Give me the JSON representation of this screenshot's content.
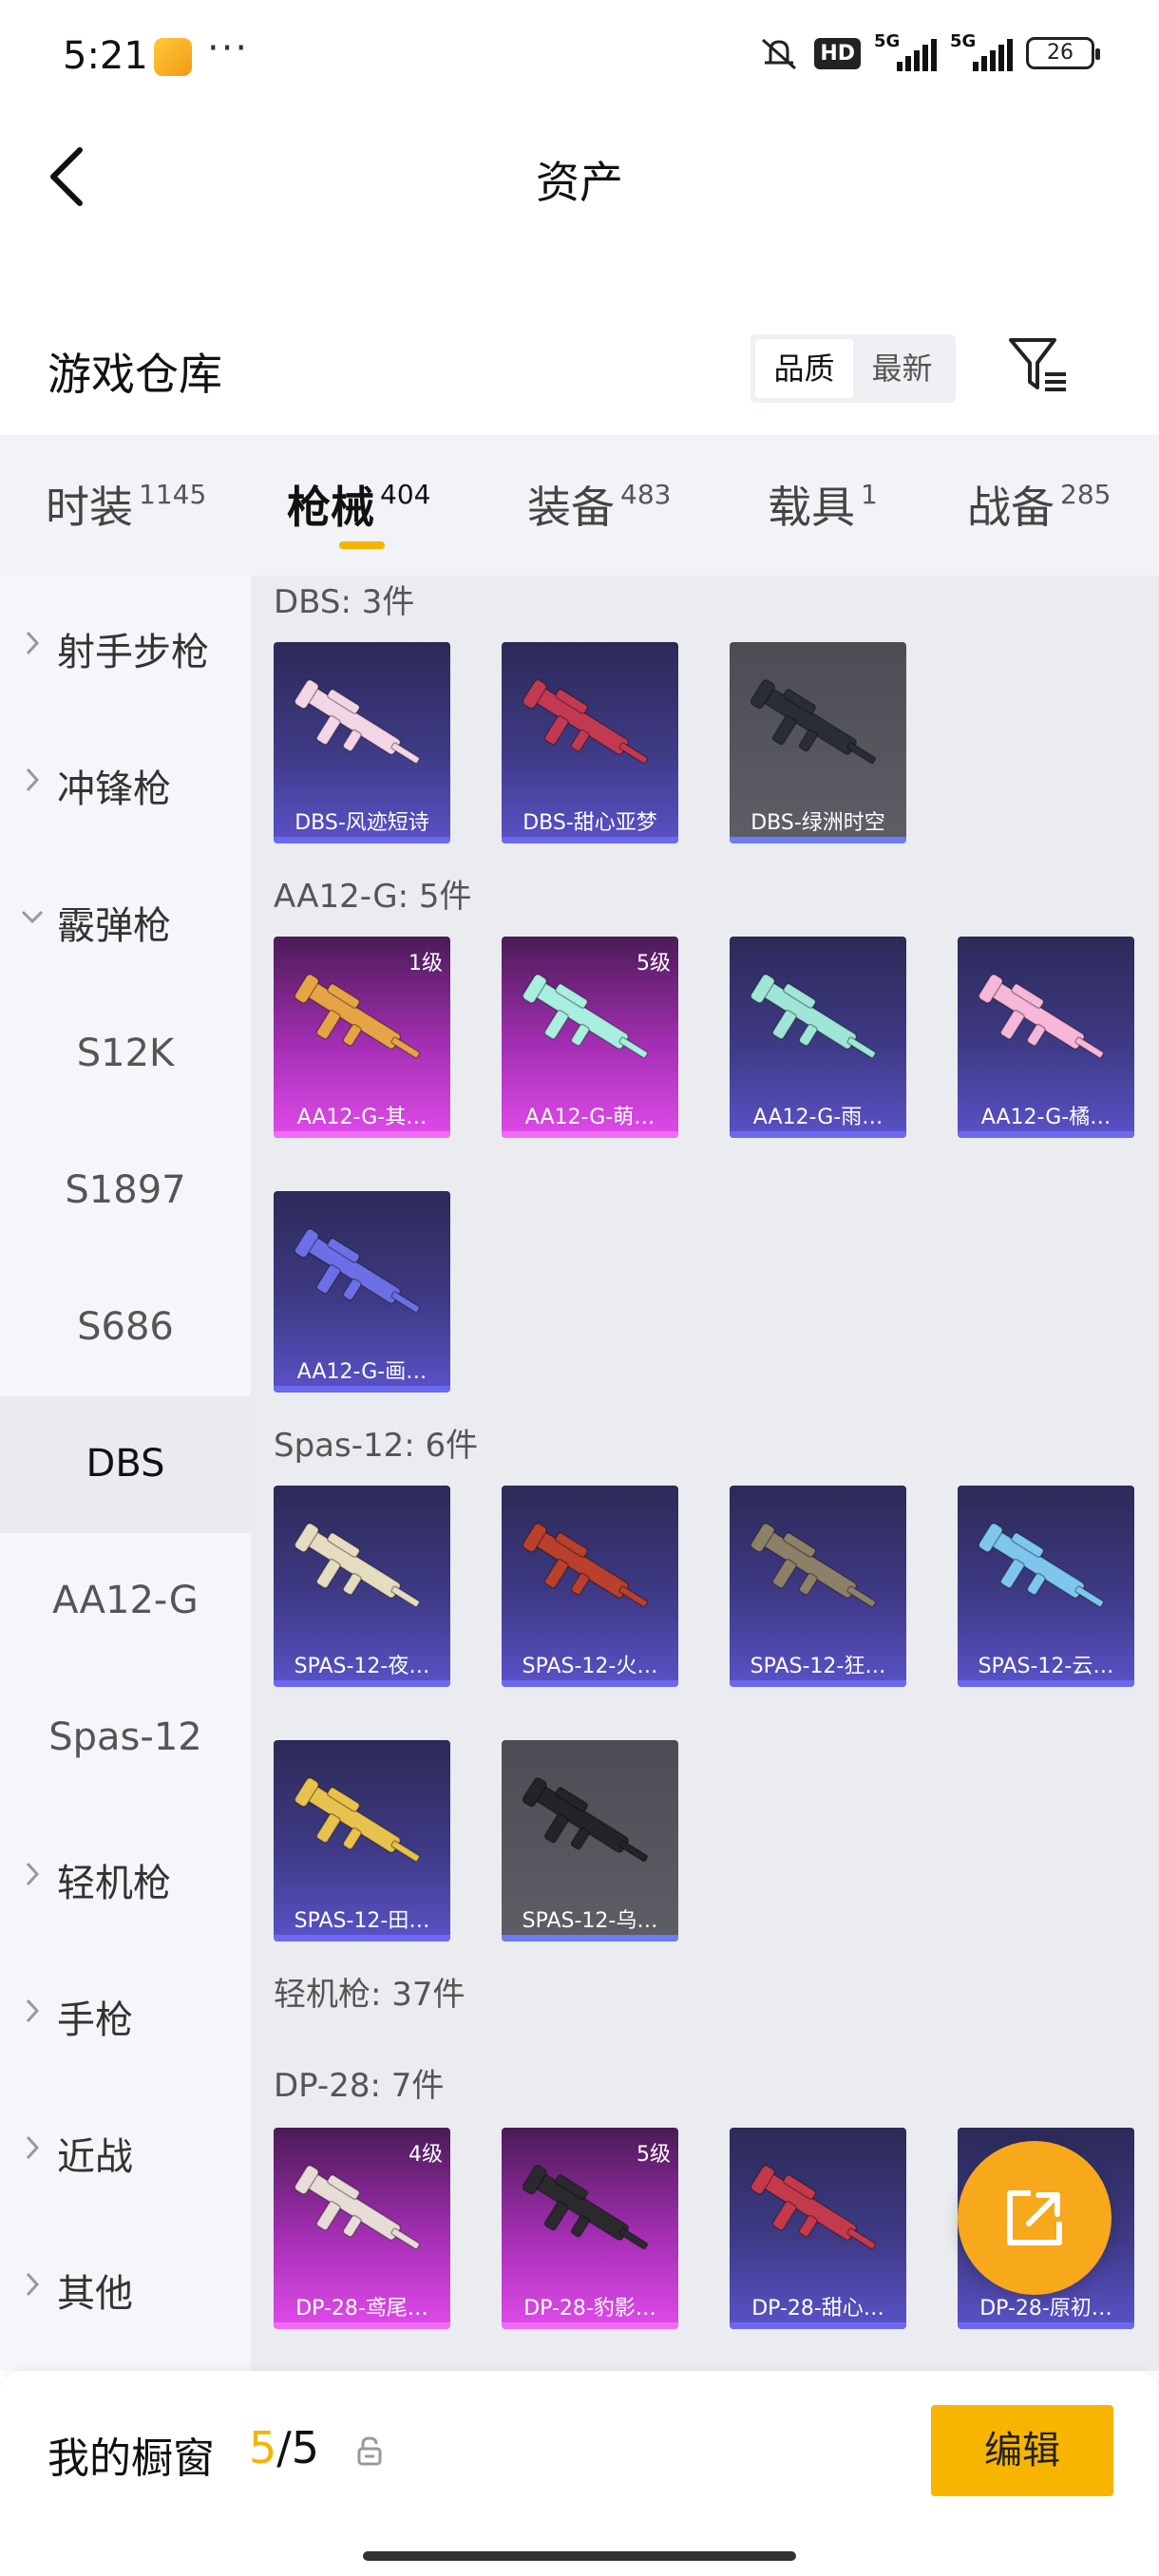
{
  "status_bar": {
    "time": "5:21",
    "dots": "···",
    "hd": "HD",
    "network1": "5G",
    "network2": "5G",
    "battery": "26"
  },
  "header": {
    "title": "资产"
  },
  "section": {
    "title": "游戏仓库",
    "sort_options": [
      "品质",
      "最新"
    ],
    "active_sort": "品质"
  },
  "tabs": [
    {
      "label": "时装",
      "count": "1145"
    },
    {
      "label": "枪械",
      "count": "404",
      "active": true
    },
    {
      "label": "装备",
      "count": "483"
    },
    {
      "label": "载具",
      "count": "1"
    },
    {
      "label": "战备",
      "count": "285"
    }
  ],
  "sidebar": [
    {
      "label": "射手步枪",
      "kind": "collapsed"
    },
    {
      "label": "冲锋枪",
      "kind": "collapsed"
    },
    {
      "label": "霰弹枪",
      "kind": "expanded"
    },
    {
      "label": "S12K",
      "kind": "sub"
    },
    {
      "label": "S1897",
      "kind": "sub"
    },
    {
      "label": "S686",
      "kind": "sub"
    },
    {
      "label": "DBS",
      "kind": "sub",
      "selected": true
    },
    {
      "label": "AA12-G",
      "kind": "sub"
    },
    {
      "label": "Spas-12",
      "kind": "sub"
    },
    {
      "label": "轻机枪",
      "kind": "collapsed"
    },
    {
      "label": "手枪",
      "kind": "collapsed"
    },
    {
      "label": "近战",
      "kind": "collapsed"
    },
    {
      "label": "其他",
      "kind": "collapsed"
    }
  ],
  "groups": {
    "dbs": {
      "label": "DBS: 3件"
    },
    "aa12": {
      "label": "AA12-G: 5件"
    },
    "spas": {
      "label": "Spas-12: 6件"
    },
    "lmg": {
      "label": "轻机枪: 37件"
    },
    "dp28": {
      "label": "DP-28: 7件"
    }
  },
  "cards": {
    "dbs": [
      {
        "name": "DBS-风迹短诗",
        "rarity": "purple",
        "gun_color": "#f3d6e6"
      },
      {
        "name": "DBS-甜心亚梦",
        "rarity": "purple",
        "gun_color": "#c23a52"
      },
      {
        "name": "DBS-绿洲时空",
        "rarity": "gray",
        "gun_color": "#2a2d36"
      }
    ],
    "aa12": [
      {
        "name": "AA12-G-其…",
        "rarity": "pink",
        "level": "1级",
        "gun_color": "#e6a446"
      },
      {
        "name": "AA12-G-萌…",
        "rarity": "pink",
        "level": "5级",
        "gun_color": "#a8efe0"
      },
      {
        "name": "AA12-G-雨…",
        "rarity": "purple",
        "gun_color": "#9fe6d8"
      },
      {
        "name": "AA12-G-橘…",
        "rarity": "purple",
        "gun_color": "#f6b7d8"
      },
      {
        "name": "AA12-G-画…",
        "rarity": "purple",
        "gun_color": "#6d6fe6"
      }
    ],
    "spas": [
      {
        "name": "SPAS-12-夜…",
        "rarity": "purple",
        "gun_color": "#e6dcc0"
      },
      {
        "name": "SPAS-12-火…",
        "rarity": "purple",
        "gun_color": "#b8402d"
      },
      {
        "name": "SPAS-12-狂…",
        "rarity": "purple",
        "gun_color": "#8c8068"
      },
      {
        "name": "SPAS-12-云…",
        "rarity": "purple",
        "gun_color": "#7fc6ef"
      },
      {
        "name": "SPAS-12-田…",
        "rarity": "purple",
        "gun_color": "#e8c24e"
      },
      {
        "name": "SPAS-12-乌…",
        "rarity": "gray",
        "gun_color": "#222428"
      }
    ],
    "dp28": [
      {
        "name": "DP-28-鸢尾…",
        "rarity": "pink",
        "level": "4级",
        "gun_color": "#e7dcd6"
      },
      {
        "name": "DP-28-豹影…",
        "rarity": "pink",
        "level": "5级",
        "gun_color": "#2a2a2e"
      },
      {
        "name": "DP-28-甜心…",
        "rarity": "purple",
        "gun_color": "#c43a4c"
      },
      {
        "name": "DP-28-原初…",
        "rarity": "purple",
        "gun_color": "#3a3a48"
      }
    ]
  },
  "bottom_bar": {
    "label": "我的橱窗",
    "current": "5",
    "separator": "/",
    "total": "5",
    "edit_label": "编辑"
  },
  "colors": {
    "accent": "#f5b400",
    "fab": "#f7a81b",
    "purple_rarity": "#6d68f0",
    "pink_rarity": "#f06cf5"
  }
}
